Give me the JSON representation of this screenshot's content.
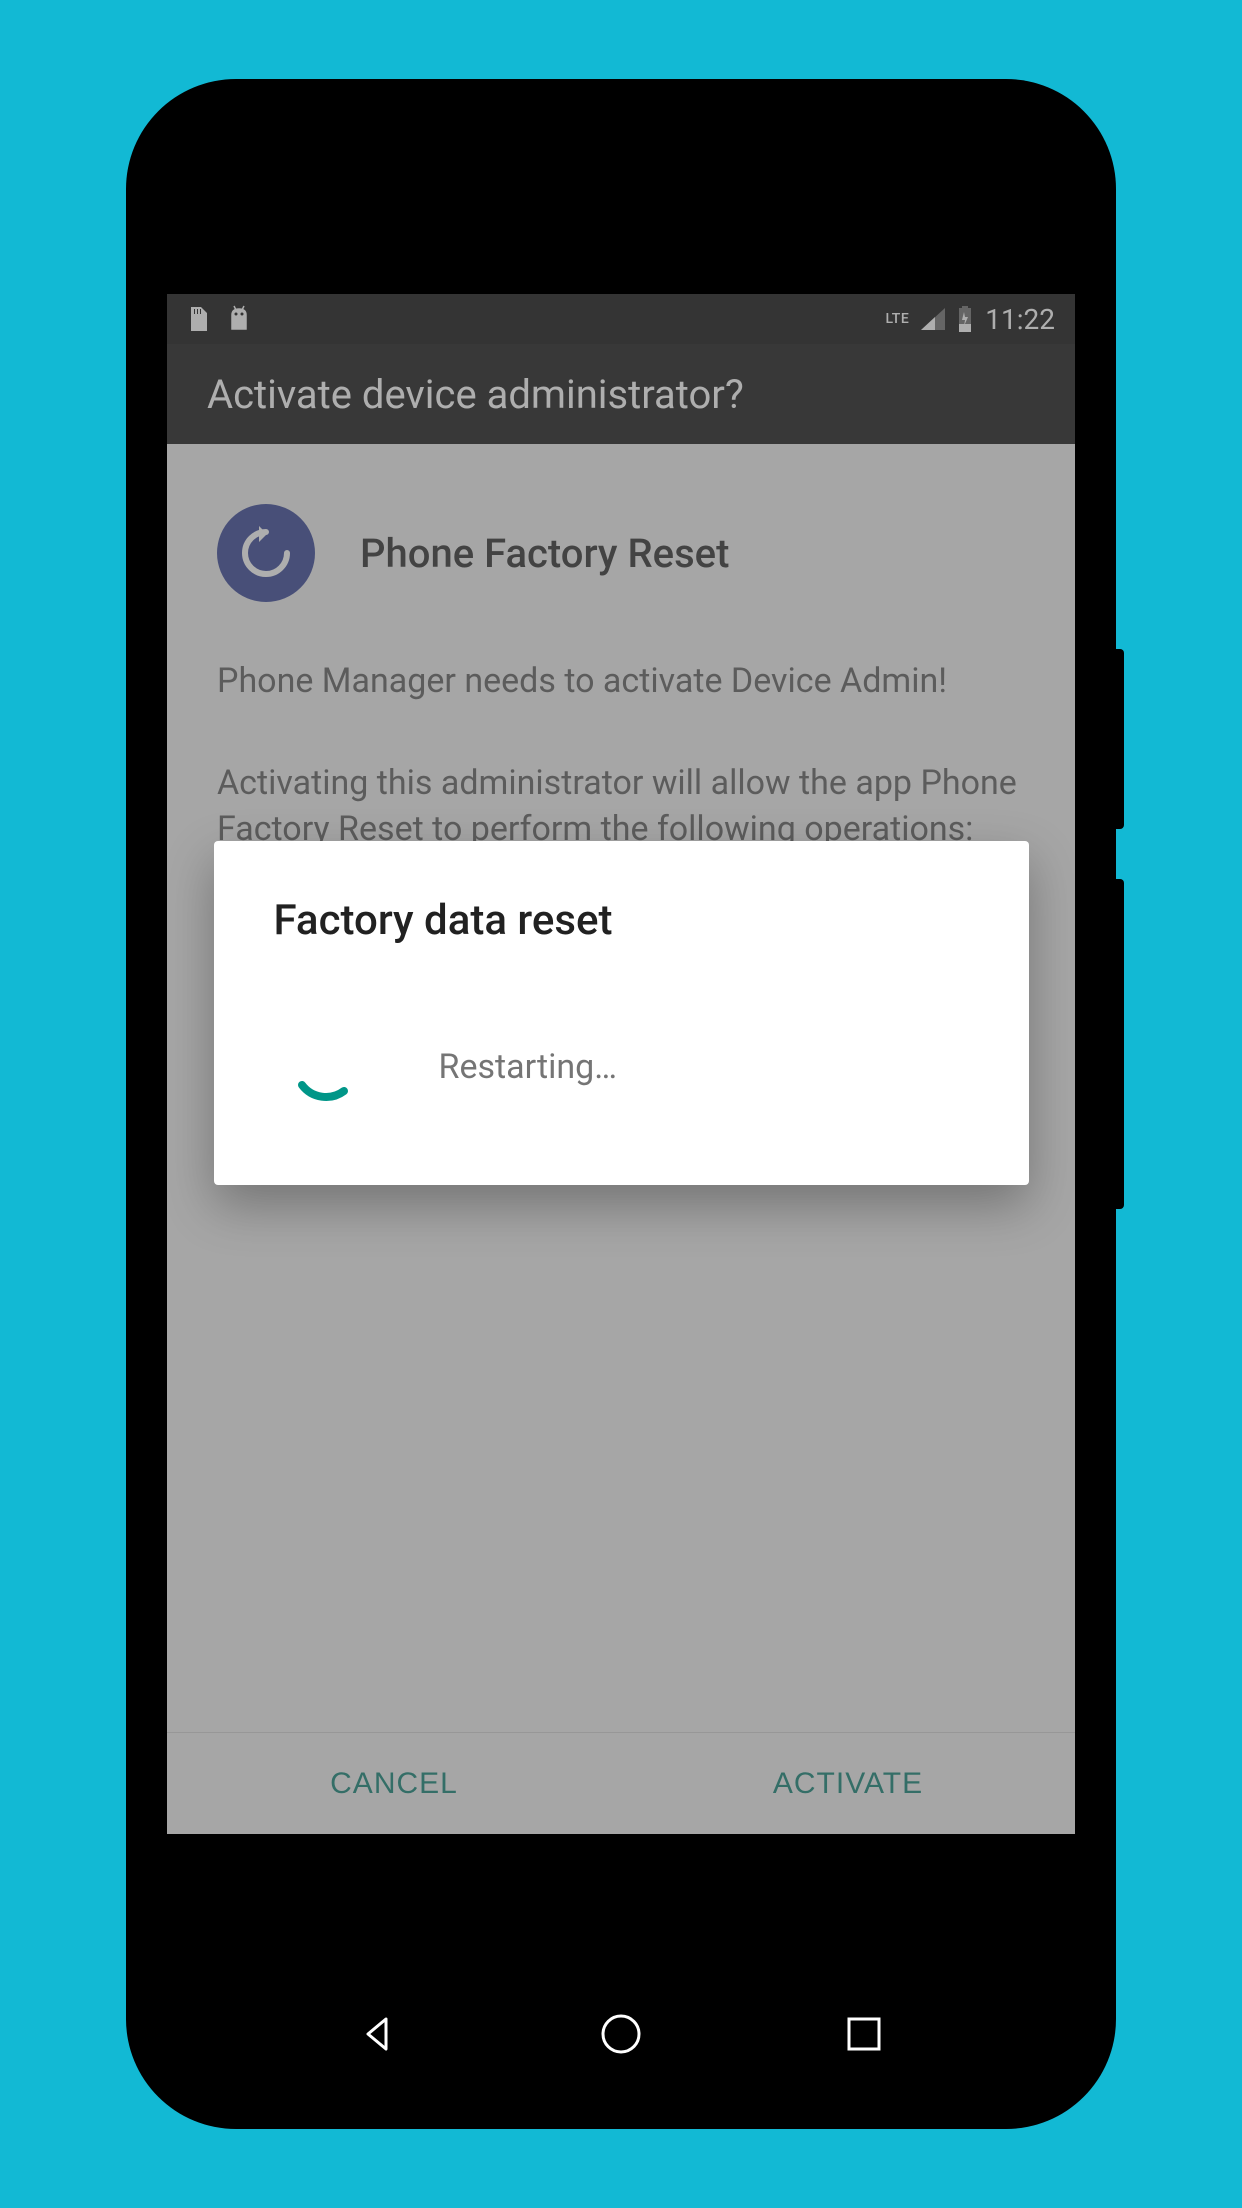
{
  "statusBar": {
    "lte": "LTE",
    "time": "11:22"
  },
  "header": {
    "title": "Activate device administrator?"
  },
  "content": {
    "appTitle": "Phone Factory Reset",
    "description": "Phone Manager needs to activate Device Admin!",
    "description2": "Activating this administrator will allow the app Phone Factory Reset to perform the following operations:"
  },
  "buttons": {
    "cancel": "CANCEL",
    "activate": "ACTIVATE"
  },
  "dialog": {
    "title": "Factory data reset",
    "status": "Restarting…"
  }
}
